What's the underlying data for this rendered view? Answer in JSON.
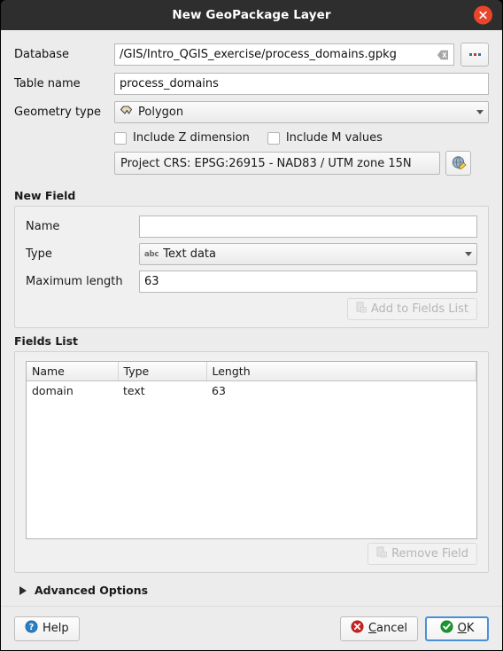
{
  "titlebar": {
    "title": "New GeoPackage Layer",
    "close_icon": "close-icon"
  },
  "form": {
    "database": {
      "label": "Database",
      "value": "/GIS/Intro_QGIS_exercise/process_domains.gpkg",
      "clear_icon": "clear-icon",
      "browse_label": "..."
    },
    "table_name": {
      "label": "Table name",
      "value": "process_domains",
      "placeholder": ""
    },
    "geometry_type": {
      "label": "Geometry type",
      "value": "Polygon",
      "icon": "polygon-icon"
    },
    "include_z": {
      "label": "Include Z dimension",
      "checked": false
    },
    "include_m": {
      "label": "Include M values",
      "checked": false
    },
    "crs": {
      "value": "Project CRS: EPSG:26915 - NAD83 / UTM zone 15N",
      "select_button_icon": "crs-globe-icon"
    }
  },
  "new_field": {
    "title": "New Field",
    "name": {
      "label": "Name",
      "value": "",
      "placeholder": ""
    },
    "type": {
      "label": "Type",
      "value": "Text data",
      "icon_text": "abc"
    },
    "max_length": {
      "label": "Maximum length",
      "value": "63"
    },
    "add_button": {
      "label": "Add to Fields List",
      "enabled": false
    }
  },
  "fields_list": {
    "title": "Fields List",
    "columns": [
      "Name",
      "Type",
      "Length"
    ],
    "rows": [
      {
        "name": "domain",
        "type": "text",
        "length": "63"
      }
    ],
    "remove_button": {
      "label": "Remove Field",
      "enabled": false
    }
  },
  "advanced_options": {
    "label": "Advanced Options",
    "expanded": false
  },
  "footer": {
    "help": "Help",
    "cancel_pre": "C",
    "cancel_post": "ancel",
    "ok_pre": "O",
    "ok_post": "K"
  },
  "colors": {
    "titlebar_bg": "#2e2e2e",
    "close_red": "#e8452a",
    "dialog_bg": "#ececec",
    "focus_blue": "#4a90d9",
    "cancel_red": "#cc2222",
    "ok_green": "#1a9a2e"
  }
}
